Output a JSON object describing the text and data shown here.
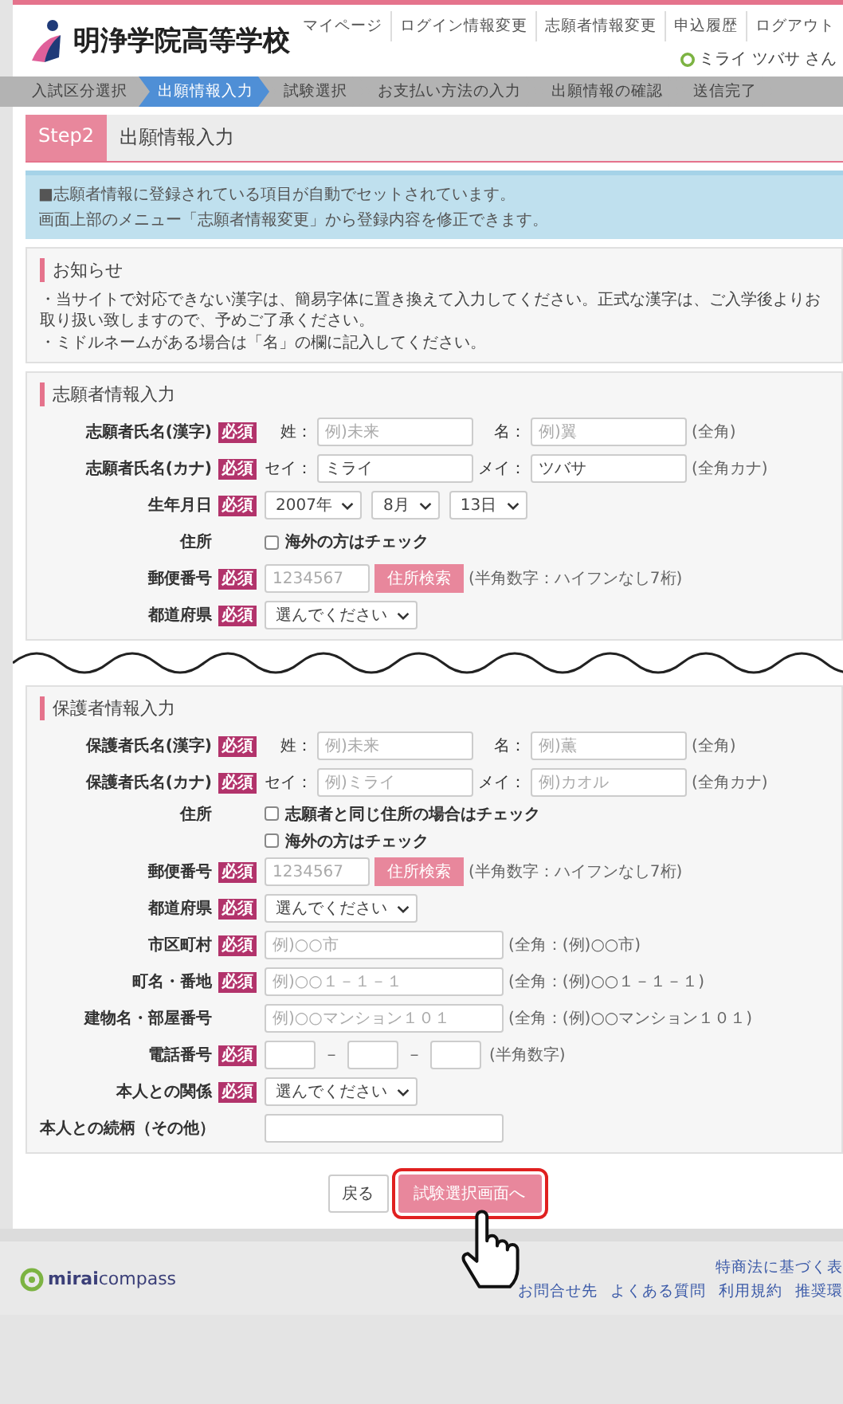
{
  "header": {
    "school_name": "明浄学院高等学校",
    "nav": [
      "マイページ",
      "ログイン情報変更",
      "志願者情報変更",
      "申込履歴",
      "ログアウト"
    ],
    "user": "ミライ ツバサ さん"
  },
  "steps": [
    {
      "label": "入試区分選択",
      "selected": false
    },
    {
      "label": "出願情報入力",
      "selected": true
    },
    {
      "label": "試験選択",
      "selected": false
    },
    {
      "label": "お支払い方法の入力",
      "selected": false
    },
    {
      "label": "出願情報の確認",
      "selected": false
    },
    {
      "label": "送信完了",
      "selected": false
    }
  ],
  "step_heading": {
    "badge": "Step2",
    "title": "出願情報入力"
  },
  "info_box": [
    "■志願者情報に登録されている項目が自動でセットされています。",
    "画面上部のメニュー「志願者情報変更」から登録内容を修正できます。"
  ],
  "notice": {
    "title": "お知らせ",
    "lines": [
      "・当サイトで対応できない漢字は、簡易字体に置き換えて入力してください。正式な漢字は、ご入学後よりお取り扱い致しますので、予めご了承ください。",
      "・ミドルネームがある場合は「名」の欄に記入してください。"
    ]
  },
  "applicant": {
    "title": "志願者情報入力",
    "rows": [
      {
        "kind": "name",
        "label": "志願者氏名(漢字)",
        "required_badge": "必須",
        "fields": [
          {
            "prefix": "姓：",
            "placeholder": "例)未来"
          },
          {
            "prefix": "名：",
            "placeholder": "例)翼"
          }
        ],
        "note": "(全角)"
      },
      {
        "kind": "name",
        "label": "志願者氏名(カナ)",
        "required_badge": "必須",
        "fields": [
          {
            "prefix": "セイ：",
            "value": "ミライ"
          },
          {
            "prefix": "メイ：",
            "value": "ツバサ"
          }
        ],
        "note": "(全角カナ)"
      },
      {
        "kind": "selects",
        "label": "生年月日",
        "required_badge": "必須",
        "selects": [
          "2007年",
          "8月",
          "13日"
        ]
      },
      {
        "kind": "checks",
        "label": "住所",
        "options": [
          {
            "label": "海外の方はチェック",
            "checked": false
          }
        ]
      },
      {
        "kind": "postal",
        "label": "郵便番号",
        "required_badge": "必須",
        "placeholder": "1234567",
        "button": "住所検索",
        "note": "(半角数字：ハイフンなし7桁)"
      },
      {
        "kind": "select",
        "label": "都道府県",
        "required_badge": "必須",
        "value": "選んでください"
      }
    ]
  },
  "guardian": {
    "title": "保護者情報入力",
    "rows": [
      {
        "kind": "name",
        "label": "保護者氏名(漢字)",
        "required_badge": "必須",
        "fields": [
          {
            "prefix": "姓：",
            "placeholder": "例)未来"
          },
          {
            "prefix": "名：",
            "placeholder": "例)薫"
          }
        ],
        "note": "(全角)"
      },
      {
        "kind": "name",
        "label": "保護者氏名(カナ)",
        "required_badge": "必須",
        "fields": [
          {
            "prefix": "セイ：",
            "placeholder": "例)ミライ"
          },
          {
            "prefix": "メイ：",
            "placeholder": "例)カオル"
          }
        ],
        "note": "(全角カナ)"
      },
      {
        "kind": "checks",
        "label": "住所",
        "options": [
          {
            "label": "志願者と同じ住所の場合はチェック",
            "checked": false
          },
          {
            "label": "海外の方はチェック",
            "checked": false
          }
        ]
      },
      {
        "kind": "postal",
        "label": "郵便番号",
        "required_badge": "必須",
        "placeholder": "1234567",
        "button": "住所検索",
        "note": "(半角数字：ハイフンなし7桁)"
      },
      {
        "kind": "select",
        "label": "都道府県",
        "required_badge": "必須",
        "value": "選んでください"
      },
      {
        "kind": "text",
        "label": "市区町村",
        "required_badge": "必須",
        "placeholder": "例)○○市",
        "note": "(全角：(例)○○市)"
      },
      {
        "kind": "text",
        "label": "町名・番地",
        "required_badge": "必須",
        "placeholder": "例)○○１－１－１",
        "note": "(全角：(例)○○１－１－１)"
      },
      {
        "kind": "text",
        "label": "建物名・部屋番号",
        "placeholder": "例)○○マンション１０１",
        "note": "(全角：(例)○○マンション１０１)"
      },
      {
        "kind": "phone",
        "label": "電話番号",
        "required_badge": "必須",
        "separators": [
          "－",
          "－"
        ],
        "note": "(半角数字)"
      },
      {
        "kind": "select",
        "label": "本人との関係",
        "required_badge": "必須",
        "value": "選んでください"
      },
      {
        "kind": "text",
        "label": "本人との続柄（その他）"
      }
    ]
  },
  "buttons": {
    "back": "戻る",
    "next": "試験選択画面へ"
  },
  "footer": {
    "logo": "**mirai**compass",
    "links_top": [
      "特商法に基づく表"
    ],
    "links": [
      "お問合せ先",
      "よくある質問",
      "利用規約",
      "推奨環"
    ]
  }
}
